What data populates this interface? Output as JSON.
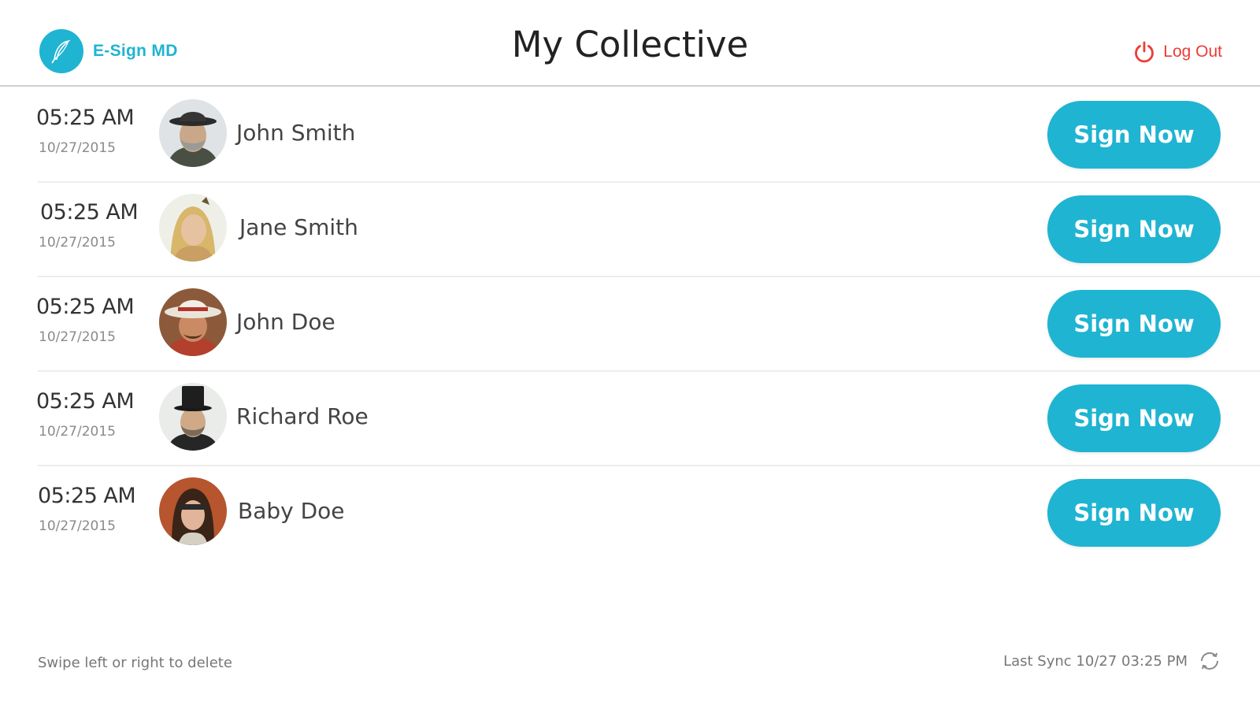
{
  "header": {
    "logo_text": "E-Sign MD",
    "title": "My Collective",
    "logout_label": "Log Out"
  },
  "rows": [
    {
      "time": "05:25 AM",
      "date": "10/27/2015",
      "name": "John Smith",
      "button": "Sign Now",
      "avatar": "person-hat-beard-avatar"
    },
    {
      "time": "05:25 AM",
      "date": "10/27/2015",
      "name": "Jane Smith",
      "button": "Sign Now",
      "avatar": "person-blonde-avatar"
    },
    {
      "time": "05:25 AM",
      "date": "10/27/2015",
      "name": "John Doe",
      "button": "Sign Now",
      "avatar": "person-cowboy-hat-avatar"
    },
    {
      "time": "05:25 AM",
      "date": "10/27/2015",
      "name": "Richard Roe",
      "button": "Sign Now",
      "avatar": "person-top-hat-avatar"
    },
    {
      "time": "05:25 AM",
      "date": "10/27/2015",
      "name": "Baby Doe",
      "button": "Sign Now",
      "avatar": "person-headband-avatar"
    }
  ],
  "footer": {
    "hint": "Swipe left or right to delete",
    "last_sync": "Last Sync 10/27 03:25 PM"
  },
  "colors": {
    "accent": "#1fb4d2",
    "logout": "#ee3b37"
  }
}
